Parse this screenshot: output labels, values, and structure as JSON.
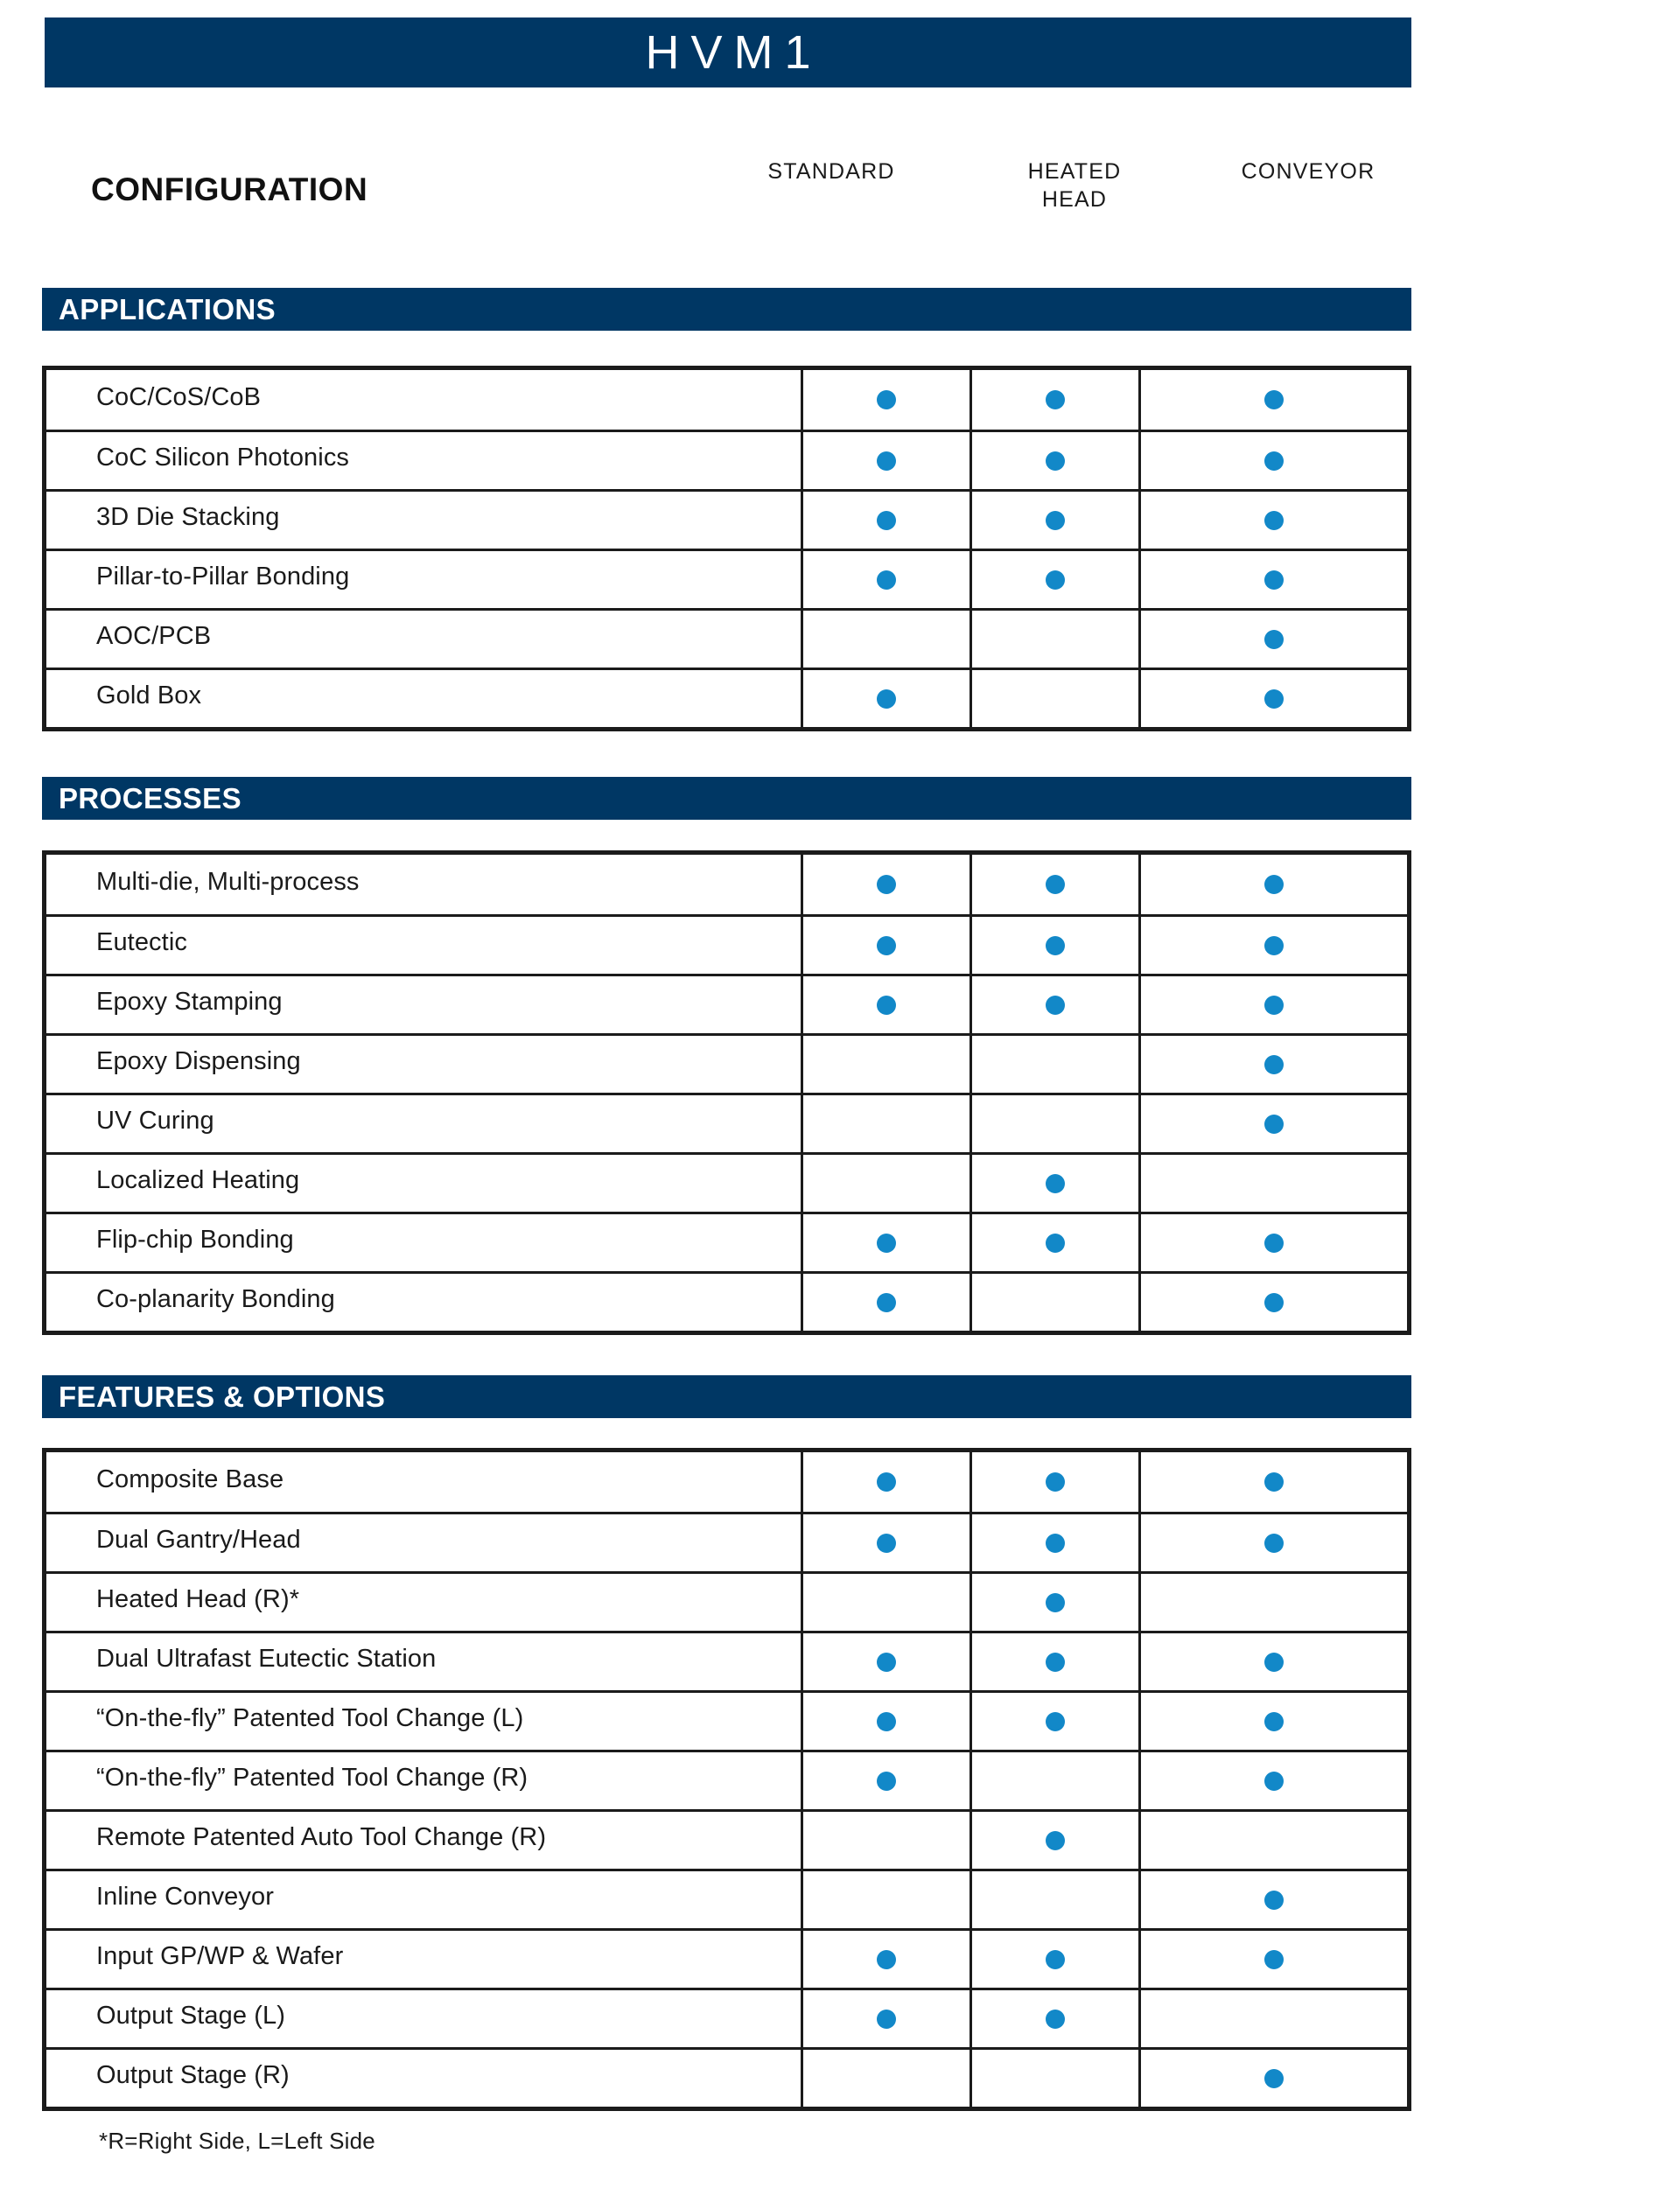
{
  "header": {
    "title": "HVM1",
    "config_label": "CONFIGURATION",
    "columns": [
      {
        "label": "STANDARD"
      },
      {
        "label": "HEATED\nHEAD"
      },
      {
        "label": "CONVEYOR"
      }
    ]
  },
  "colors": {
    "navy": "#003764",
    "dot_blue": "#1288c8",
    "border_black": "#1b1b1b",
    "text": "#1a1a1a"
  },
  "sections": [
    {
      "title": "APPLICATIONS",
      "rows": [
        {
          "label": "CoC/CoS/CoB",
          "marks": [
            true,
            true,
            true
          ]
        },
        {
          "label": "CoC Silicon Photonics",
          "marks": [
            true,
            true,
            true
          ]
        },
        {
          "label": "3D Die Stacking",
          "marks": [
            true,
            true,
            true
          ]
        },
        {
          "label": "Pillar-to-Pillar Bonding",
          "marks": [
            true,
            true,
            true
          ]
        },
        {
          "label": "AOC/PCB",
          "marks": [
            false,
            false,
            true
          ]
        },
        {
          "label": "Gold Box",
          "marks": [
            true,
            false,
            true
          ]
        }
      ]
    },
    {
      "title": "PROCESSES",
      "rows": [
        {
          "label": "Multi-die, Multi-process",
          "marks": [
            true,
            true,
            true
          ]
        },
        {
          "label": "Eutectic",
          "marks": [
            true,
            true,
            true
          ]
        },
        {
          "label": "Epoxy Stamping",
          "marks": [
            true,
            true,
            true
          ]
        },
        {
          "label": "Epoxy Dispensing",
          "marks": [
            false,
            false,
            true
          ]
        },
        {
          "label": "UV Curing",
          "marks": [
            false,
            false,
            true
          ]
        },
        {
          "label": "Localized Heating",
          "marks": [
            false,
            true,
            false
          ]
        },
        {
          "label": "Flip-chip Bonding",
          "marks": [
            true,
            true,
            true
          ]
        },
        {
          "label": "Co-planarity Bonding",
          "marks": [
            true,
            false,
            true
          ]
        }
      ]
    },
    {
      "title": "FEATURES & OPTIONS",
      "rows": [
        {
          "label": "Composite Base",
          "marks": [
            true,
            true,
            true
          ]
        },
        {
          "label": "Dual Gantry/Head",
          "marks": [
            true,
            true,
            true
          ]
        },
        {
          "label": "Heated Head (R)*",
          "marks": [
            false,
            true,
            false
          ]
        },
        {
          "label": "Dual Ultrafast Eutectic Station",
          "marks": [
            true,
            true,
            true
          ]
        },
        {
          "label": "“On-the-fly” Patented Tool Change (L)",
          "marks": [
            true,
            true,
            true
          ]
        },
        {
          "label": "“On-the-fly” Patented Tool Change (R)",
          "marks": [
            true,
            false,
            true
          ]
        },
        {
          "label": "Remote Patented Auto Tool Change (R)",
          "marks": [
            false,
            true,
            false
          ]
        },
        {
          "label": "Inline Conveyor",
          "marks": [
            false,
            false,
            true
          ]
        },
        {
          "label": "Input GP/WP & Wafer",
          "marks": [
            true,
            true,
            true
          ]
        },
        {
          "label": "Output Stage (L)",
          "marks": [
            true,
            true,
            false
          ]
        },
        {
          "label": "Output Stage (R)",
          "marks": [
            false,
            false,
            true
          ]
        }
      ]
    }
  ],
  "footnote": "*R=Right Side, L=Left Side"
}
